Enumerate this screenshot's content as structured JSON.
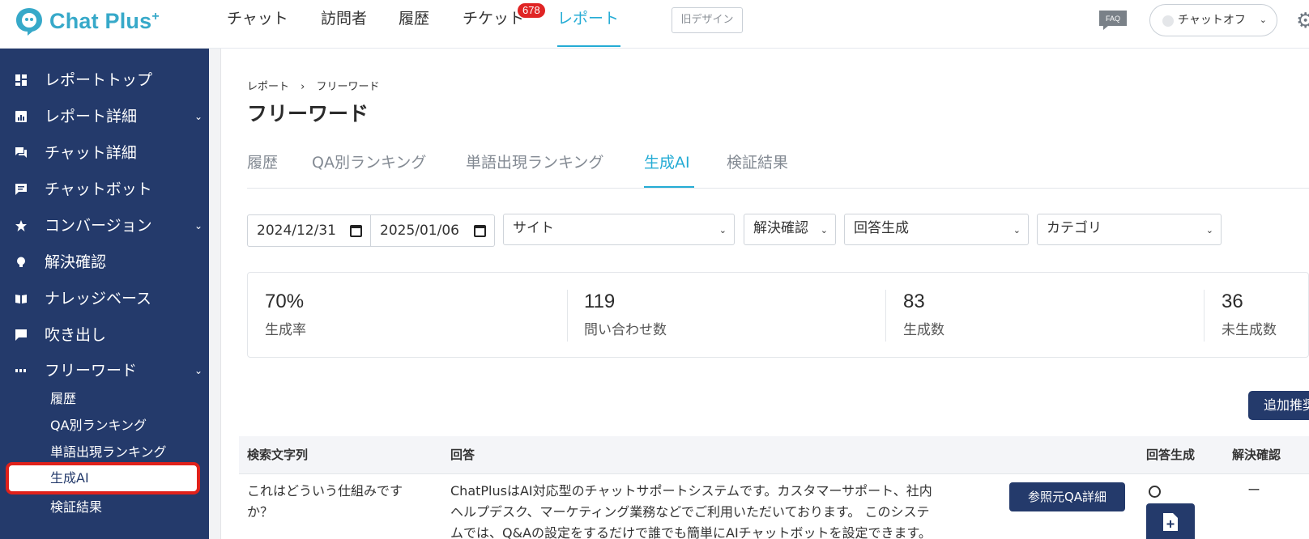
{
  "header": {
    "logo_text": "Chat Plus",
    "logo_plus": "+",
    "nav": [
      {
        "label": "チャット"
      },
      {
        "label": "訪問者"
      },
      {
        "label": "履歴"
      },
      {
        "label": "チケット",
        "badge": "678"
      },
      {
        "label": "レポート",
        "active": true
      }
    ],
    "old_design_label": "旧デザイン",
    "faq_label": "FAQ",
    "status_label": "チャットオフ"
  },
  "sidebar": {
    "items": [
      {
        "label": "レポートトップ",
        "icon": "dashboard-icon"
      },
      {
        "label": "レポート詳細",
        "icon": "report-icon",
        "expandable": true
      },
      {
        "label": "チャット詳細",
        "icon": "chat-icon"
      },
      {
        "label": "チャットボット",
        "icon": "bot-message-icon"
      },
      {
        "label": "コンバージョン",
        "icon": "star-icon",
        "expandable": true
      },
      {
        "label": "解決確認",
        "icon": "bulb-icon"
      },
      {
        "label": "ナレッジベース",
        "icon": "book-icon"
      },
      {
        "label": "吹き出し",
        "icon": "speech-bubble-icon"
      },
      {
        "label": "フリーワード",
        "icon": "abc-icon",
        "expandable": true
      }
    ],
    "sub_items": [
      {
        "label": "履歴"
      },
      {
        "label": "QA別ランキング"
      },
      {
        "label": "単語出現ランキング"
      },
      {
        "label": "生成AI",
        "active": true
      },
      {
        "label": "検証結果"
      }
    ]
  },
  "main": {
    "breadcrumb": {
      "parent": "レポート",
      "separator": "›",
      "current": "フリーワード"
    },
    "title": "フリーワード",
    "tabs": [
      {
        "label": "履歴"
      },
      {
        "label": "QA別ランキング"
      },
      {
        "label": "単語出現ランキング"
      },
      {
        "label": "生成AI",
        "active": true
      },
      {
        "label": "検証結果"
      }
    ],
    "filters": {
      "date_from": "2024/12/31",
      "date_to": "2025/01/06",
      "site": "サイト",
      "resolve": "解決確認",
      "answer_gen": "回答生成",
      "category": "カテゴリ"
    },
    "stats": [
      {
        "value": "70%",
        "label": "生成率"
      },
      {
        "value": "119",
        "label": "問い合わせ数"
      },
      {
        "value": "83",
        "label": "生成数"
      },
      {
        "value": "36",
        "label": "未生成数"
      }
    ],
    "add_button_label": "追加推奨",
    "table": {
      "headers": [
        "検索文字列",
        "回答",
        "回答生成",
        "解決確認"
      ],
      "rows": [
        {
          "query_line1": "これはどういう仕組みです",
          "query_line2": "か？",
          "answer_line1": "ChatPlusはAI対応型のチャットサポートシステムです。カスタマーサポート、社内",
          "answer_line2": "ヘルプデスク、マーケティング業務などでご利用いただいております。 このシステ",
          "answer_line3": "ムでは、Q&Aの設定をするだけで誰でも簡単にAIチャットボットを設定できます。",
          "ref_button": "参照元QA詳細",
          "generated": "○",
          "resolved": "ー"
        }
      ]
    }
  },
  "colors": {
    "sidebar_bg": "#243a6b",
    "accent": "#25acd5",
    "badge": "#e02424",
    "highlight": "#e0211b"
  }
}
